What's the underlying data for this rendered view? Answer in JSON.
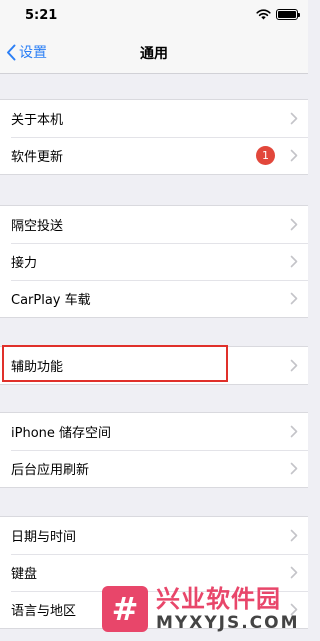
{
  "status_bar": {
    "time": "5:21",
    "icons": [
      "wifi-icon",
      "battery-icon"
    ]
  },
  "nav": {
    "back_label": "设置",
    "title": "通用"
  },
  "sections": [
    {
      "rows": [
        {
          "label": "关于本机"
        },
        {
          "label": "软件更新",
          "badge": "1"
        }
      ]
    },
    {
      "rows": [
        {
          "label": "隔空投送"
        },
        {
          "label": "接力"
        },
        {
          "label": "CarPlay 车载"
        }
      ]
    },
    {
      "rows": [
        {
          "label": "辅助功能",
          "highlighted": true
        }
      ]
    },
    {
      "rows": [
        {
          "label": "iPhone 储存空间"
        },
        {
          "label": "后台应用刷新"
        }
      ]
    },
    {
      "rows": [
        {
          "label": "日期与时间"
        },
        {
          "label": "键盘"
        },
        {
          "label": "语言与地区"
        }
      ]
    }
  ],
  "watermark": {
    "logo_glyph": "#",
    "title": "兴业软件园",
    "subtitle": "MYXYJS.COM"
  },
  "colors": {
    "accent": "#2b7ff6",
    "badge": "#e2473b",
    "highlight_border": "#e0302a",
    "watermark": "#e8466a"
  }
}
